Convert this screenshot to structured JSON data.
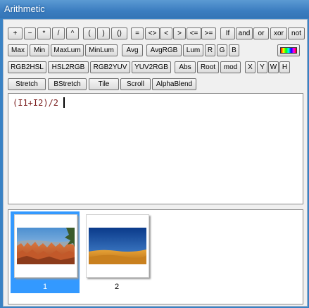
{
  "window": {
    "title": "Arithmetic"
  },
  "toolbar": {
    "row1": [
      "+",
      "−",
      "*",
      "/",
      "^",
      "(",
      ")",
      "()",
      "=",
      "<>",
      "<",
      ">",
      "<=",
      ">=",
      "If",
      "and",
      "or",
      "xor",
      "not"
    ],
    "row2": [
      "Max",
      "Min",
      "MaxLum",
      "MinLum",
      "Avg",
      "AvgRGB",
      "Lum",
      "R",
      "G",
      "B"
    ],
    "row3": [
      "RGB2HSL",
      "HSL2RGB",
      "RGB2YUV",
      "YUV2RGB",
      "Abs",
      "Root",
      "mod",
      "X",
      "Y",
      "W",
      "H"
    ],
    "row4": [
      "Stretch",
      "BStretch",
      "Tile",
      "Scroll",
      "AlphaBlend"
    ],
    "palette_icon": "color-palette-icon"
  },
  "editor": {
    "expression": "(I1+I2)/2"
  },
  "gallery": {
    "items": [
      {
        "label": "1",
        "selected": true,
        "image": "canyon-hoodoos-photo"
      },
      {
        "label": "2",
        "selected": false,
        "image": "desert-dunes-photo"
      }
    ]
  },
  "colors": {
    "titlebar": "#3b7dc0",
    "selection": "#3399ff",
    "expression_text": "#7a1e1e"
  }
}
